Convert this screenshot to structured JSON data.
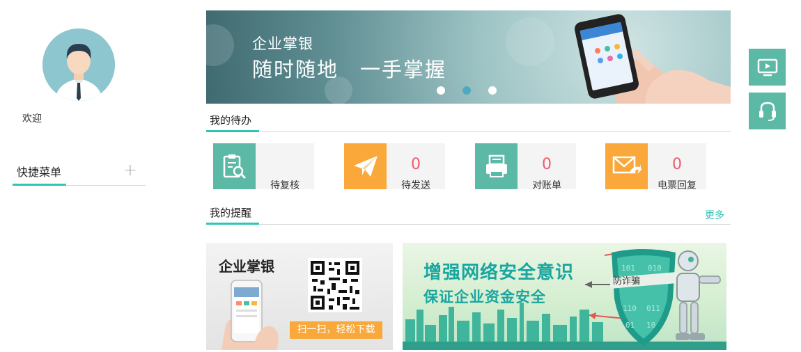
{
  "user": {
    "welcome": "欢迎"
  },
  "quick_menu": {
    "title": "快捷菜单",
    "add_icon": "+"
  },
  "banner": {
    "line1": "企业掌银",
    "line2": "随时随地　一手掌握",
    "active_slide": 2,
    "slide_count": 3
  },
  "todo": {
    "title": "我的待办",
    "items": [
      {
        "label": "待复核",
        "count": "",
        "icon": "clipboard-search-icon",
        "color": "#5bb9a6"
      },
      {
        "label": "待发送",
        "count": "0",
        "icon": "paper-plane-icon",
        "color": "#f9a839"
      },
      {
        "label": "对账单",
        "count": "0",
        "icon": "printer-icon",
        "color": "#5bb9a6"
      },
      {
        "label": "电票回复",
        "count": "0",
        "icon": "envelope-reply-icon",
        "color": "#f9a839"
      }
    ]
  },
  "reminders": {
    "title": "我的提醒",
    "more": "更多"
  },
  "promo_app": {
    "title": "企业掌银",
    "tag": "扫一扫，轻松下载"
  },
  "promo_security": {
    "line1": "增强网络安全意识",
    "line2": "保证企业资金安全",
    "shield": "防诈骗"
  },
  "side_buttons": [
    {
      "icon": "tv-play-icon"
    },
    {
      "icon": "headset-icon"
    }
  ],
  "colors": {
    "accent": "#2ec4b6",
    "tile_green": "#5bb9a6",
    "tile_orange": "#f9a839",
    "count_red": "#ef5a6f"
  }
}
